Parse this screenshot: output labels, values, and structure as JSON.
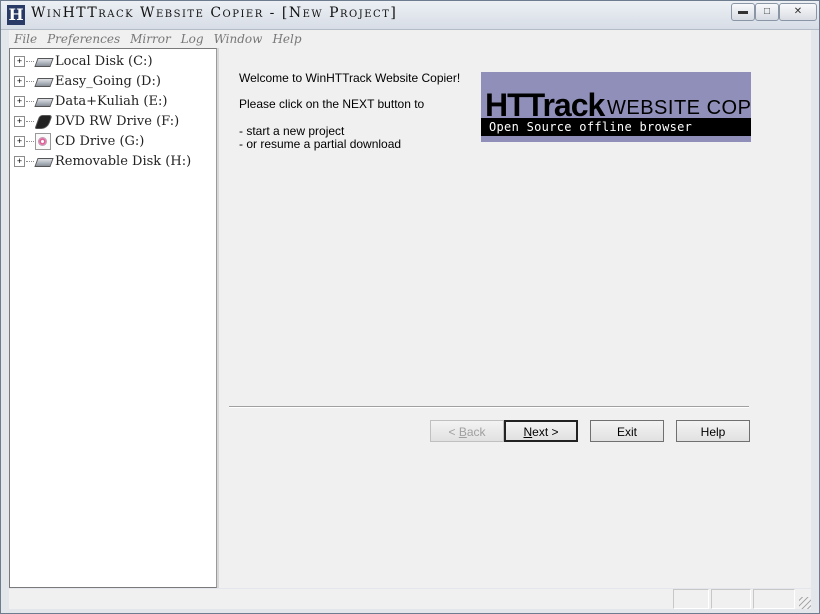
{
  "window": {
    "title": "WinHTTrack Website Copier - [New Project]",
    "icon_letter": "H",
    "controls": {
      "minimize": "▬",
      "maximize": "□",
      "close": "✕"
    }
  },
  "menu": [
    "File",
    "Preferences",
    "Mirror",
    "Log",
    "Window",
    "Help"
  ],
  "tree": {
    "items": [
      {
        "label": "Local Disk (C:)",
        "icon": "hard-drive-icon"
      },
      {
        "label": "Easy_Going (D:)",
        "icon": "hard-drive-icon"
      },
      {
        "label": "Data+Kuliah (E:)",
        "icon": "hard-drive-icon"
      },
      {
        "label": "DVD RW Drive (F:)",
        "icon": "dvd-drive-icon"
      },
      {
        "label": "CD Drive (G:)",
        "icon": "cd-drive-icon"
      },
      {
        "label": "Removable Disk (H:)",
        "icon": "removable-disk-icon"
      }
    ],
    "expander": "+"
  },
  "main": {
    "welcome_line1": "Welcome to WinHTTrack Website Copier!",
    "welcome_line2": "Please click on the NEXT button to",
    "bullet1": "- start a new project",
    "bullet2": "- or resume a partial download"
  },
  "logo": {
    "big": "HTTrack",
    "site": "WEBSITE COPIER",
    "tagline": "Open Source offline browser"
  },
  "buttons": {
    "back_accel": "B",
    "back_rest": "ack",
    "back_prefix": "< ",
    "next_accel": "N",
    "next_rest": "ext >",
    "exit": "Exit",
    "help": "Help"
  }
}
